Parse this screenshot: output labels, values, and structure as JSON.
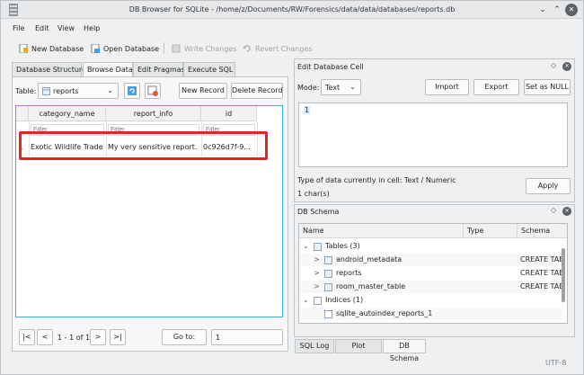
{
  "window": {
    "title": "DB Browser for SQLite - /home/z/Documents/RW/Forensics/data/data/databases/reports.db",
    "minimize": "⌄",
    "maximize": "⌃",
    "close": "✕"
  },
  "menu": [
    "File",
    "Edit",
    "View",
    "Help"
  ],
  "toolbar": {
    "new_database": "New Database",
    "open_database": "Open Database",
    "write_changes": "Write Changes",
    "revert_changes": "Revert Changes"
  },
  "tabs": [
    "Database Structure",
    "Browse Data",
    "Edit Pragmas",
    "Execute SQL"
  ],
  "browse": {
    "table_label": "Table:",
    "table_value": "reports",
    "new_record": "New Record",
    "delete_record": "Delete Record",
    "columns": [
      "category_name",
      "report_info",
      "id"
    ],
    "filter_placeholder": "Filter",
    "rows": [
      {
        "num": "1",
        "cells": [
          "Exotic Wildlife Trade",
          "My very sensitive report.",
          "0c926d7f-9..."
        ]
      }
    ],
    "pager": {
      "first": "|<",
      "prev": "<",
      "range": "1 - 1 of 1",
      "next": ">",
      "last": ">|",
      "goto": "Go to:",
      "goto_value": "1"
    }
  },
  "edit_cell": {
    "title": "Edit Database Cell",
    "mode_label": "Mode:",
    "mode_value": "Text",
    "import": "Import",
    "export": "Export",
    "set_null": "Set as NULL",
    "value": "1",
    "type_info": "Type of data currently in cell: Text / Numeric",
    "size_info": "1 char(s)",
    "apply": "Apply"
  },
  "schema": {
    "title": "DB Schema",
    "columns": [
      "Name",
      "Type",
      "Schema"
    ],
    "items": [
      {
        "label": "Tables (3)",
        "schema": "",
        "level": 0,
        "toggle": "⌄"
      },
      {
        "label": "android_metadata",
        "schema": "CREATE TAB",
        "level": 1,
        "toggle": ">"
      },
      {
        "label": "reports",
        "schema": "CREATE TAB",
        "level": 1,
        "toggle": ">"
      },
      {
        "label": "room_master_table",
        "schema": "CREATE TAB",
        "level": 1,
        "toggle": ">"
      },
      {
        "label": "Indices (1)",
        "schema": "",
        "level": 0,
        "toggle": "⌄"
      },
      {
        "label": "sqlite_autoindex_reports_1",
        "schema": "",
        "level": 1,
        "toggle": ""
      }
    ]
  },
  "bottom_tabs": [
    "SQL Log",
    "Plot",
    "DB Schema"
  ],
  "status": {
    "encoding": "UTF-8"
  },
  "colors": {
    "highlight": "#e4261f",
    "accent": "#3daee9"
  }
}
